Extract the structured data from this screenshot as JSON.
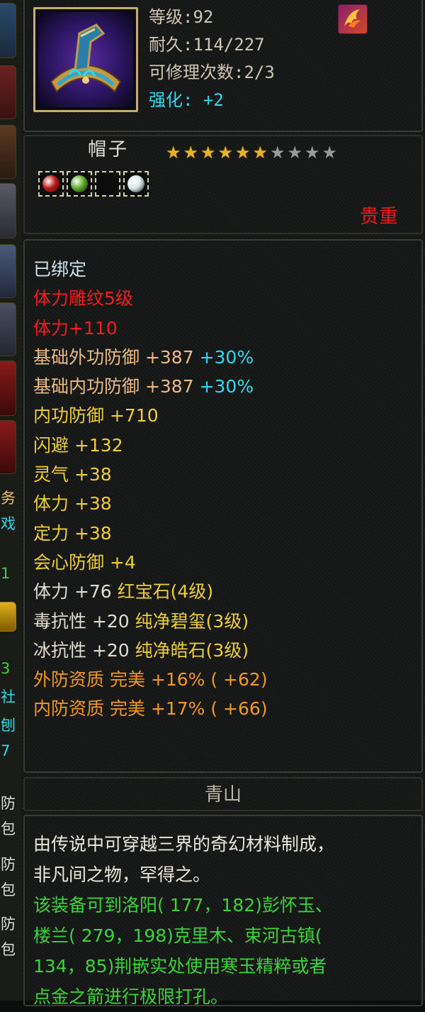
{
  "left_strip": {
    "characters": [
      "务",
      "戏",
      "1",
      "3",
      "社",
      "刨",
      "7",
      "防",
      "包",
      "防",
      "包",
      "防",
      "包"
    ]
  },
  "header": {
    "icon": "hat-equipment-icon",
    "level_label": "等级",
    "level_value": "92",
    "durability_label": "耐久",
    "durability_value": "114/227",
    "repair_label": "可修理次数",
    "repair_value": "2/3",
    "enhance_label": "强化",
    "enhance_value": "+2",
    "badge_icon": "fire-wing-icon"
  },
  "title": {
    "item_name": "帽子",
    "stars_total": 10,
    "stars_filled": 6,
    "gem_slots": [
      {
        "icon": "red-gem-icon",
        "color": "#c01818"
      },
      {
        "icon": "green-gem-icon",
        "color": "#5fae2a"
      },
      {
        "icon": "empty-slot-icon",
        "color": ""
      },
      {
        "icon": "white-gem-icon",
        "color": "#d8e8e8"
      }
    ],
    "rarity": "贵重"
  },
  "stats": [
    {
      "parts": [
        {
          "text": "已绑定",
          "color": "pale"
        }
      ]
    },
    {
      "parts": [
        {
          "text": "体力雕纹5级",
          "color": "red"
        }
      ]
    },
    {
      "parts": [
        {
          "text": "体力+110",
          "color": "red"
        }
      ]
    },
    {
      "parts": [
        {
          "text": "基础外功防御 +387 ",
          "color": "peach"
        },
        {
          "text": "+30%",
          "color": "cyan"
        }
      ]
    },
    {
      "parts": [
        {
          "text": "基础内功防御 +387 ",
          "color": "peach"
        },
        {
          "text": "+30%",
          "color": "cyan"
        }
      ]
    },
    {
      "parts": [
        {
          "text": "内功防御 +710",
          "color": "yellow"
        }
      ]
    },
    {
      "parts": [
        {
          "text": "闪避 +132",
          "color": "yellow"
        }
      ]
    },
    {
      "parts": [
        {
          "text": "灵气 +38",
          "color": "yellow"
        }
      ]
    },
    {
      "parts": [
        {
          "text": "体力 +38",
          "color": "yellow"
        }
      ]
    },
    {
      "parts": [
        {
          "text": "定力 +38",
          "color": "yellow"
        }
      ]
    },
    {
      "parts": [
        {
          "text": "会心防御 +4",
          "color": "yellow"
        }
      ]
    },
    {
      "parts": [
        {
          "text": "体力 +76 ",
          "color": "white"
        },
        {
          "text": "红宝石(4级)",
          "color": "yellow"
        }
      ]
    },
    {
      "parts": [
        {
          "text": "毒抗性 +20 ",
          "color": "white"
        },
        {
          "text": "纯净碧玺(3级)",
          "color": "yellow"
        }
      ]
    },
    {
      "parts": [
        {
          "text": "冰抗性 +20 ",
          "color": "white"
        },
        {
          "text": "纯净皓石(3级)",
          "color": "yellow"
        }
      ]
    },
    {
      "parts": [
        {
          "text": "外防资质  完美 +16% ( +62)",
          "color": "orange"
        }
      ]
    },
    {
      "parts": [
        {
          "text": "内防资质  完美 +17% ( +66)",
          "color": "orange"
        }
      ]
    }
  ],
  "origin": "青山",
  "description": {
    "lines": [
      {
        "text": "由传说中可穿越三界的奇幻材料制成，",
        "color": "white"
      },
      {
        "text": "非凡间之物，罕得之。",
        "color": "white"
      },
      {
        "text": "该装备可到洛阳( 177，182)彭怀玉、",
        "color": "green"
      },
      {
        "text": "楼兰( 279，198)克里木、束河古镇(",
        "color": "green"
      },
      {
        "text": "134，85)荆嵌实处使用寒玉精粹或者",
        "color": "green"
      },
      {
        "text": "点金之箭进行极限打孔。",
        "color": "green"
      }
    ]
  },
  "colors": {
    "white": "#e2ddd0",
    "pale": "#cce4ee",
    "red": "#f01e1e",
    "peach": "#ecbb84",
    "yellow": "#edce33",
    "orange": "#f39a1b",
    "cyan": "#2fd9ee",
    "green": "#3ad43a"
  }
}
